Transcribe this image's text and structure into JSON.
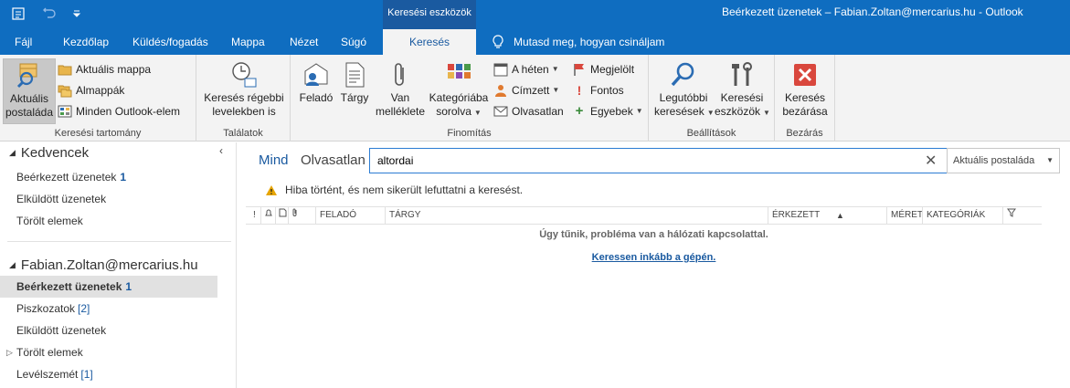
{
  "titlebar": {
    "context_tab": "Keresési eszközök",
    "window_title": "Beérkezett üzenetek – Fabian.Zoltan@mercarius.hu  -  Outlook"
  },
  "tabs": [
    {
      "label": "Fájl"
    },
    {
      "label": "Kezdőlap"
    },
    {
      "label": "Küldés/fogadás"
    },
    {
      "label": "Mappa"
    },
    {
      "label": "Nézet"
    },
    {
      "label": "Súgó"
    },
    {
      "label": "Keresés",
      "active": true
    }
  ],
  "tellme": "Mutasd meg, hogyan csináljam",
  "ribbon": {
    "scope": {
      "label": "Keresési tartomány",
      "current_mailbox": "Aktuális postaláda",
      "current_folder": "Aktuális mappa",
      "subfolders": "Almappák",
      "all_outlook_items": "Minden Outlook-elem"
    },
    "results": {
      "label": "Találatok",
      "older": "Keresés régebbi levelekben is"
    },
    "refine": {
      "label": "Finomítás",
      "from": "Feladó",
      "subject": "Tárgy",
      "has_attachments": "Van melléklete",
      "categorized": "Kategóriába sorolva",
      "this_week": "A héten",
      "sent_to": "Címzett",
      "unread": "Olvasatlan",
      "flagged": "Megjelölt",
      "important": "Fontos",
      "more": "Egyebek"
    },
    "options": {
      "label": "Beállítások",
      "recent_searches": "Legutóbbi keresések",
      "search_tools": "Keresési eszközök"
    },
    "close": {
      "label": "Bezárás",
      "close_search": "Keresés bezárása"
    }
  },
  "nav": {
    "favorites_title": "Kedvencek",
    "favorites": [
      {
        "label": "Beérkezett üzenetek",
        "count": "1"
      },
      {
        "label": "Elküldött üzenetek",
        "count": ""
      },
      {
        "label": "Törölt elemek",
        "count": ""
      }
    ],
    "account": "Fabian.Zoltan@mercarius.hu",
    "folders": [
      {
        "label": "Beérkezett üzenetek",
        "count": "1"
      },
      {
        "label": "Piszkozatok",
        "count": "[2]"
      },
      {
        "label": "Elküldött üzenetek",
        "count": ""
      },
      {
        "label": "Törölt elemek",
        "count": ""
      },
      {
        "label": "Levélszemét",
        "count": "[1]"
      }
    ]
  },
  "main": {
    "filter_all": "Mind",
    "filter_unread": "Olvasatlan",
    "search_value": "altordai",
    "scope_dropdown": "Aktuális postaláda",
    "error": "Hiba történt, és nem sikerült lefuttatni a keresést.",
    "columns": {
      "importance": "!",
      "from": "FELADÓ",
      "subject": "TÁRGY",
      "received": "ÉRKEZETT",
      "size": "MÉRET",
      "categories": "KATEGÓRIÁK"
    },
    "empty_message": "Úgy tűnik, probléma van a hálózati kapcsolattal.",
    "search_pc_link": "Keressen inkább a gépén."
  },
  "colors": {
    "brand_blue": "#0f6dc0",
    "accent_text": "#1a5aa0",
    "ribbon_bg": "#f3f3f3",
    "close_red": "#d9473d",
    "warning": "#e6a400"
  }
}
